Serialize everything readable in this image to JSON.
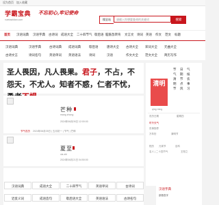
{
  "topbar": {
    "left": "设为首页",
    "right": "加入收藏"
  },
  "header": {
    "logo": "学霸宝典",
    "logo_sub": "xuebazidian.com",
    "slogan": "不忘初心,牢记使命",
    "search_select": "搜全站",
    "search_placeholder": "请输入你想要查询的关键词",
    "search_button": "搜索"
  },
  "nav": [
    "首页",
    "汉语词典",
    "汉语字典",
    "古诗词",
    "成语大全",
    "二十四节气",
    "歇后语",
    "脑筋急转弯",
    "文言文",
    "诗词",
    "英语",
    "作文",
    "范文",
    "标题"
  ],
  "subnav": [
    [
      "汉语词典",
      "汉语字典",
      "古诗词典",
      "成语词典",
      "歇后语",
      "唐诗大全",
      "古诗大全",
      "宋词大全",
      "元曲大全"
    ],
    [
      "古诗文言",
      "诗词名句",
      "英语单词",
      "英语语法",
      "诗词",
      "汉语",
      "作文大全",
      "范文大全",
      "简历写作"
    ]
  ],
  "quote": {
    "part1": "圣人畏因，凡人畏果。",
    "red1": "君子",
    "part2": "，不占，不怨天，不尤人。知者不惑，仁者不忧，勇者",
    "red2": "不惧",
    "part3": "。"
  },
  "side": {
    "term": "清明",
    "term_pinyin": "qing ming",
    "col1": [
      "节",
      "气",
      "清",
      "明",
      "节"
    ],
    "col2": [
      "日",
      "期",
      "节",
      "点",
      "风"
    ],
    "col3": [
      "气",
      "候",
      "农",
      "事",
      "习"
    ],
    "lunar_label": "农历日期",
    "weekday": "星期四",
    "news": [
      "时令天气",
      "农事指导",
      "万年历",
      "清明节"
    ],
    "foot": [
      "阳历",
      "元宵节",
      "百科",
      "名人 | 二十四节气",
      "王阳之"
    ]
  },
  "post1": {
    "title": "芒种",
    "pinyin": "mang zhong",
    "date": "2024年06月05日 12:00:00",
    "meta1": "节气农历",
    "meta2": "2024年06月05日 | 五月初一 | 节气 | 芒种"
  },
  "post2": {
    "title": "夏至",
    "pinyin": "xia zhi",
    "date": "2024年06月21日 04:50:00"
  },
  "grid": [
    [
      "汉语词典",
      "成语大全",
      "二十四节气",
      "英语单词",
      "古诗词"
    ],
    [
      "近反义词",
      "成语造句",
      "歇后语大全",
      "英语语法",
      "古诗名句"
    ]
  ],
  "side_bottom": {
    "title": "汉语字典",
    "item": "部首查字"
  }
}
